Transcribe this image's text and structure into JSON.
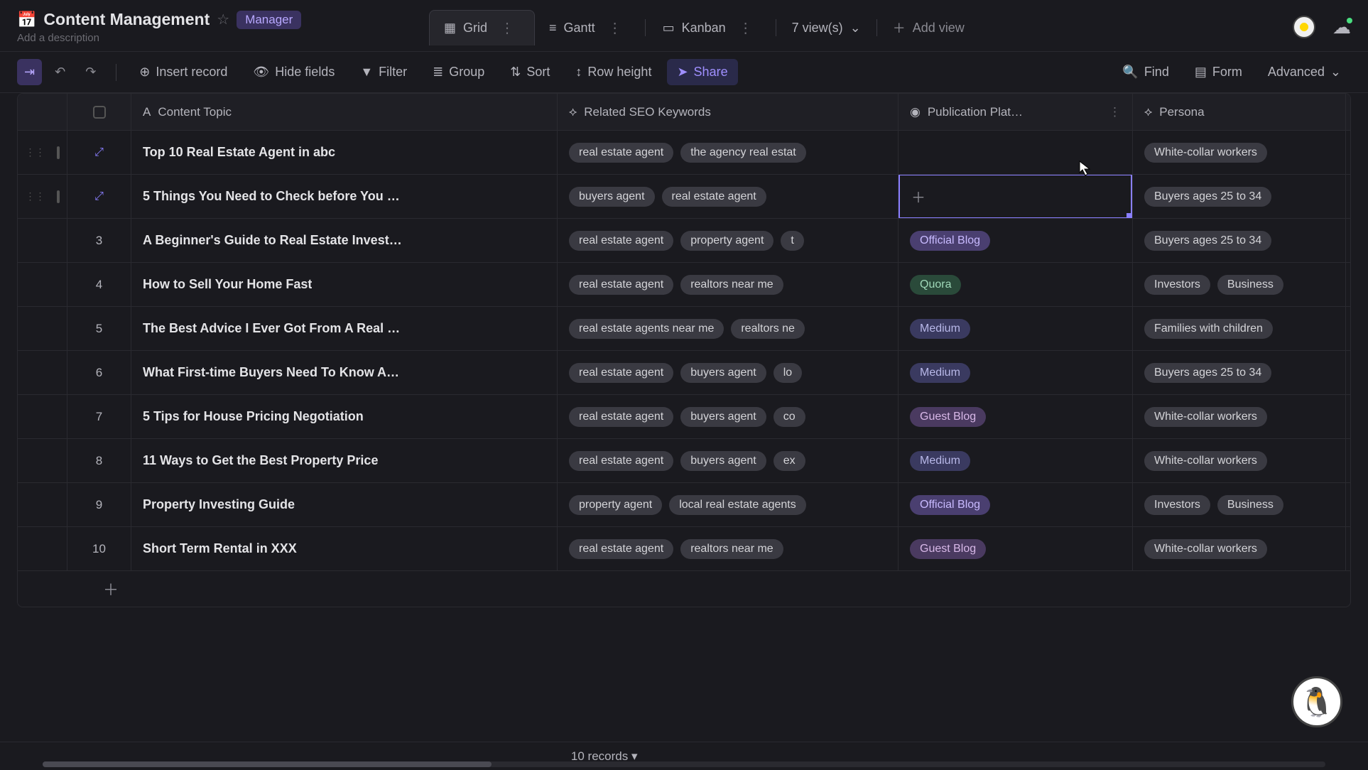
{
  "header": {
    "icon": "📅",
    "title": "Content Management",
    "role_badge": "Manager",
    "description_placeholder": "Add a description"
  },
  "views": {
    "tabs": [
      {
        "label": "Grid",
        "icon": "grid",
        "active": true
      },
      {
        "label": "Gantt",
        "icon": "gantt",
        "active": false
      },
      {
        "label": "Kanban",
        "icon": "kanban",
        "active": false
      }
    ],
    "count_label": "7 view(s)",
    "add_view_label": "Add view"
  },
  "toolbar": {
    "insert_record": "Insert record",
    "hide_fields": "Hide fields",
    "filter": "Filter",
    "group": "Group",
    "sort": "Sort",
    "row_height": "Row height",
    "share": "Share",
    "find": "Find",
    "form": "Form",
    "advanced": "Advanced"
  },
  "columns": [
    {
      "label": "Content Topic",
      "icon": "text"
    },
    {
      "label": "Related SEO Keywords",
      "icon": "link"
    },
    {
      "label": "Publication Plat…",
      "icon": "select"
    },
    {
      "label": "Persona",
      "icon": "link"
    }
  ],
  "rows": [
    {
      "num": 1,
      "hover": true,
      "topic": "Top 10 Real Estate Agent in abc",
      "keywords": [
        "real estate agent",
        "the agency real estat"
      ],
      "platform": null,
      "persona": [
        "White-collar workers"
      ]
    },
    {
      "num": 2,
      "hover": true,
      "editing": true,
      "topic": "5 Things You Need to Check before You …",
      "keywords": [
        "buyers agent",
        "real estate agent"
      ],
      "platform": null,
      "persona": [
        "Buyers ages 25 to 34"
      ]
    },
    {
      "num": 3,
      "topic": "A Beginner's Guide to Real Estate Invest…",
      "keywords": [
        "real estate agent",
        "property agent",
        "t"
      ],
      "platform": {
        "label": "Official Blog",
        "class": "official-blog"
      },
      "persona": [
        "Buyers ages 25 to 34"
      ]
    },
    {
      "num": 4,
      "topic": "How to Sell Your Home Fast",
      "keywords": [
        "real estate agent",
        "realtors near me"
      ],
      "platform": {
        "label": "Quora",
        "class": "quora"
      },
      "persona": [
        "Investors",
        "Business"
      ]
    },
    {
      "num": 5,
      "topic": "The Best Advice I Ever Got From A Real …",
      "keywords": [
        "real estate agents near me",
        "realtors ne"
      ],
      "platform": {
        "label": "Medium",
        "class": "medium"
      },
      "persona": [
        "Families with children"
      ]
    },
    {
      "num": 6,
      "topic": "What First-time Buyers Need To Know A…",
      "keywords": [
        "real estate agent",
        "buyers agent",
        "lo"
      ],
      "platform": {
        "label": "Medium",
        "class": "medium"
      },
      "persona": [
        "Buyers ages 25 to 34"
      ]
    },
    {
      "num": 7,
      "topic": "5 Tips for House Pricing Negotiation",
      "keywords": [
        "real estate agent",
        "buyers agent",
        "co"
      ],
      "platform": {
        "label": "Guest Blog",
        "class": "guest-blog"
      },
      "persona": [
        "White-collar workers"
      ]
    },
    {
      "num": 8,
      "topic": "11 Ways to Get the Best Property Price",
      "keywords": [
        "real estate agent",
        "buyers agent",
        "ex"
      ],
      "platform": {
        "label": "Medium",
        "class": "medium"
      },
      "persona": [
        "White-collar workers"
      ]
    },
    {
      "num": 9,
      "topic": "Property Investing Guide",
      "keywords": [
        "property agent",
        "local real estate agents"
      ],
      "platform": {
        "label": "Official Blog",
        "class": "official-blog"
      },
      "persona": [
        "Investors",
        "Business"
      ]
    },
    {
      "num": 10,
      "topic": "Short Term Rental in XXX",
      "keywords": [
        "real estate agent",
        "realtors near me"
      ],
      "platform": {
        "label": "Guest Blog",
        "class": "guest-blog"
      },
      "persona": [
        "White-collar workers"
      ]
    }
  ],
  "footer": {
    "records_label": "10 records ▾"
  }
}
